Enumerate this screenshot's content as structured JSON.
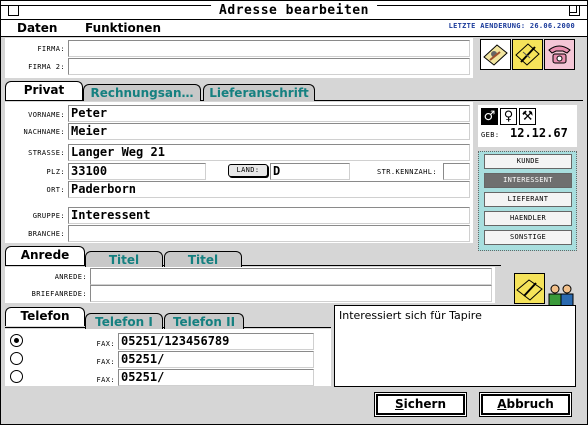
{
  "window": {
    "title": "Adresse bearbeiten",
    "last_change": "LETZTE AENDERUNG: 26.06.2000"
  },
  "menu": {
    "daten": "Daten",
    "funktionen": "Funktionen"
  },
  "firma": {
    "firma_label": "FIRMA:",
    "firma2_label": "FIRMA 2:",
    "firma": "",
    "firma2": ""
  },
  "tabs_address": [
    {
      "label": "Privat"
    },
    {
      "label": "Rechnungsan…"
    },
    {
      "label": "Lieferanschrift"
    }
  ],
  "person": {
    "vorname_label": "VORNAME:",
    "vorname": "Peter",
    "nachname_label": "NACHNAME:",
    "nachname": "Meier",
    "strasse_label": "STRASSE:",
    "strasse": "Langer Weg 21",
    "plz_label": "PLZ:",
    "plz": "33100",
    "land_label": "LAND:",
    "land": "D",
    "strkz_label": "STR.KENNZAHL:",
    "strkz": "",
    "ort_label": "ORT:",
    "ort": "Paderborn",
    "gruppe_label": "GRUPPE:",
    "gruppe": "Interessent",
    "branche_label": "BRANCHE:",
    "branche": "",
    "geb_label": "GEB:",
    "geb": "12.12.67"
  },
  "groups": [
    {
      "label": "KUNDE",
      "selected": false
    },
    {
      "label": "INTERESSENT",
      "selected": true
    },
    {
      "label": "LIEFERANT",
      "selected": false
    },
    {
      "label": "HAENDLER",
      "selected": false
    },
    {
      "label": "SONSTIGE",
      "selected": false
    }
  ],
  "tabs_anrede": [
    {
      "label": "Anrede"
    },
    {
      "label": "Titel"
    },
    {
      "label": "Titel"
    }
  ],
  "anrede": {
    "anrede_label": "ANREDE:",
    "briefanrede_label": "BRIEFANREDE:",
    "anrede": "",
    "briefanrede": ""
  },
  "tabs_telefon": [
    {
      "label": "Telefon"
    },
    {
      "label": "Telefon I"
    },
    {
      "label": "Telefon II"
    }
  ],
  "phones": [
    {
      "label": "FAX:",
      "value": "05251/123456789",
      "selected": true
    },
    {
      "label": "FAX:",
      "value": "05251/",
      "selected": false
    },
    {
      "label": "FAX:",
      "value": "05251/",
      "selected": false
    }
  ],
  "notes": "Interessiert sich für Tapire",
  "buttons": {
    "save": "Sichern",
    "cancel": "Abbruch"
  },
  "colors": {
    "accent_teal": "#158080",
    "group_panel": "#a8dede",
    "date_blue": "#1a3a9a"
  }
}
